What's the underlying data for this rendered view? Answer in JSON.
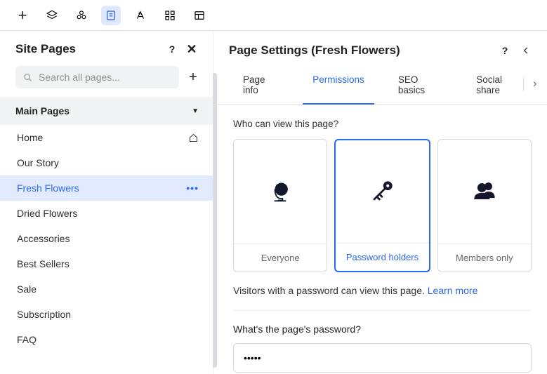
{
  "app": {
    "left": {
      "title": "Site Pages",
      "search_placeholder": "Search all pages...",
      "section_main": "Main Pages",
      "pages": [
        {
          "label": "Home",
          "selected": false,
          "home": true
        },
        {
          "label": "Our Story",
          "selected": false
        },
        {
          "label": "Fresh Flowers",
          "selected": true
        },
        {
          "label": "Dried Flowers",
          "selected": false
        },
        {
          "label": "Accessories",
          "selected": false
        },
        {
          "label": "Best Sellers",
          "selected": false
        },
        {
          "label": "Sale",
          "selected": false
        },
        {
          "label": "Subscription",
          "selected": false
        },
        {
          "label": "FAQ",
          "selected": false
        }
      ]
    },
    "right": {
      "title": "Page Settings (Fresh Flowers)",
      "tabs": [
        {
          "label": "Page info",
          "active": false
        },
        {
          "label": "Permissions",
          "active": true
        },
        {
          "label": "SEO basics",
          "active": false
        },
        {
          "label": "Social share",
          "active": false
        }
      ],
      "permissions": {
        "view_label": "Who can view this page?",
        "options": [
          {
            "label": "Everyone",
            "icon": "globe",
            "selected": false
          },
          {
            "label": "Password holders",
            "icon": "key",
            "selected": true
          },
          {
            "label": "Members only",
            "icon": "members",
            "selected": false
          }
        ],
        "desc_text": "Visitors with a password can view this page. ",
        "learn_more": "Learn more",
        "pw_label": "What's the page's password?",
        "pw_value": "•••••"
      }
    }
  }
}
